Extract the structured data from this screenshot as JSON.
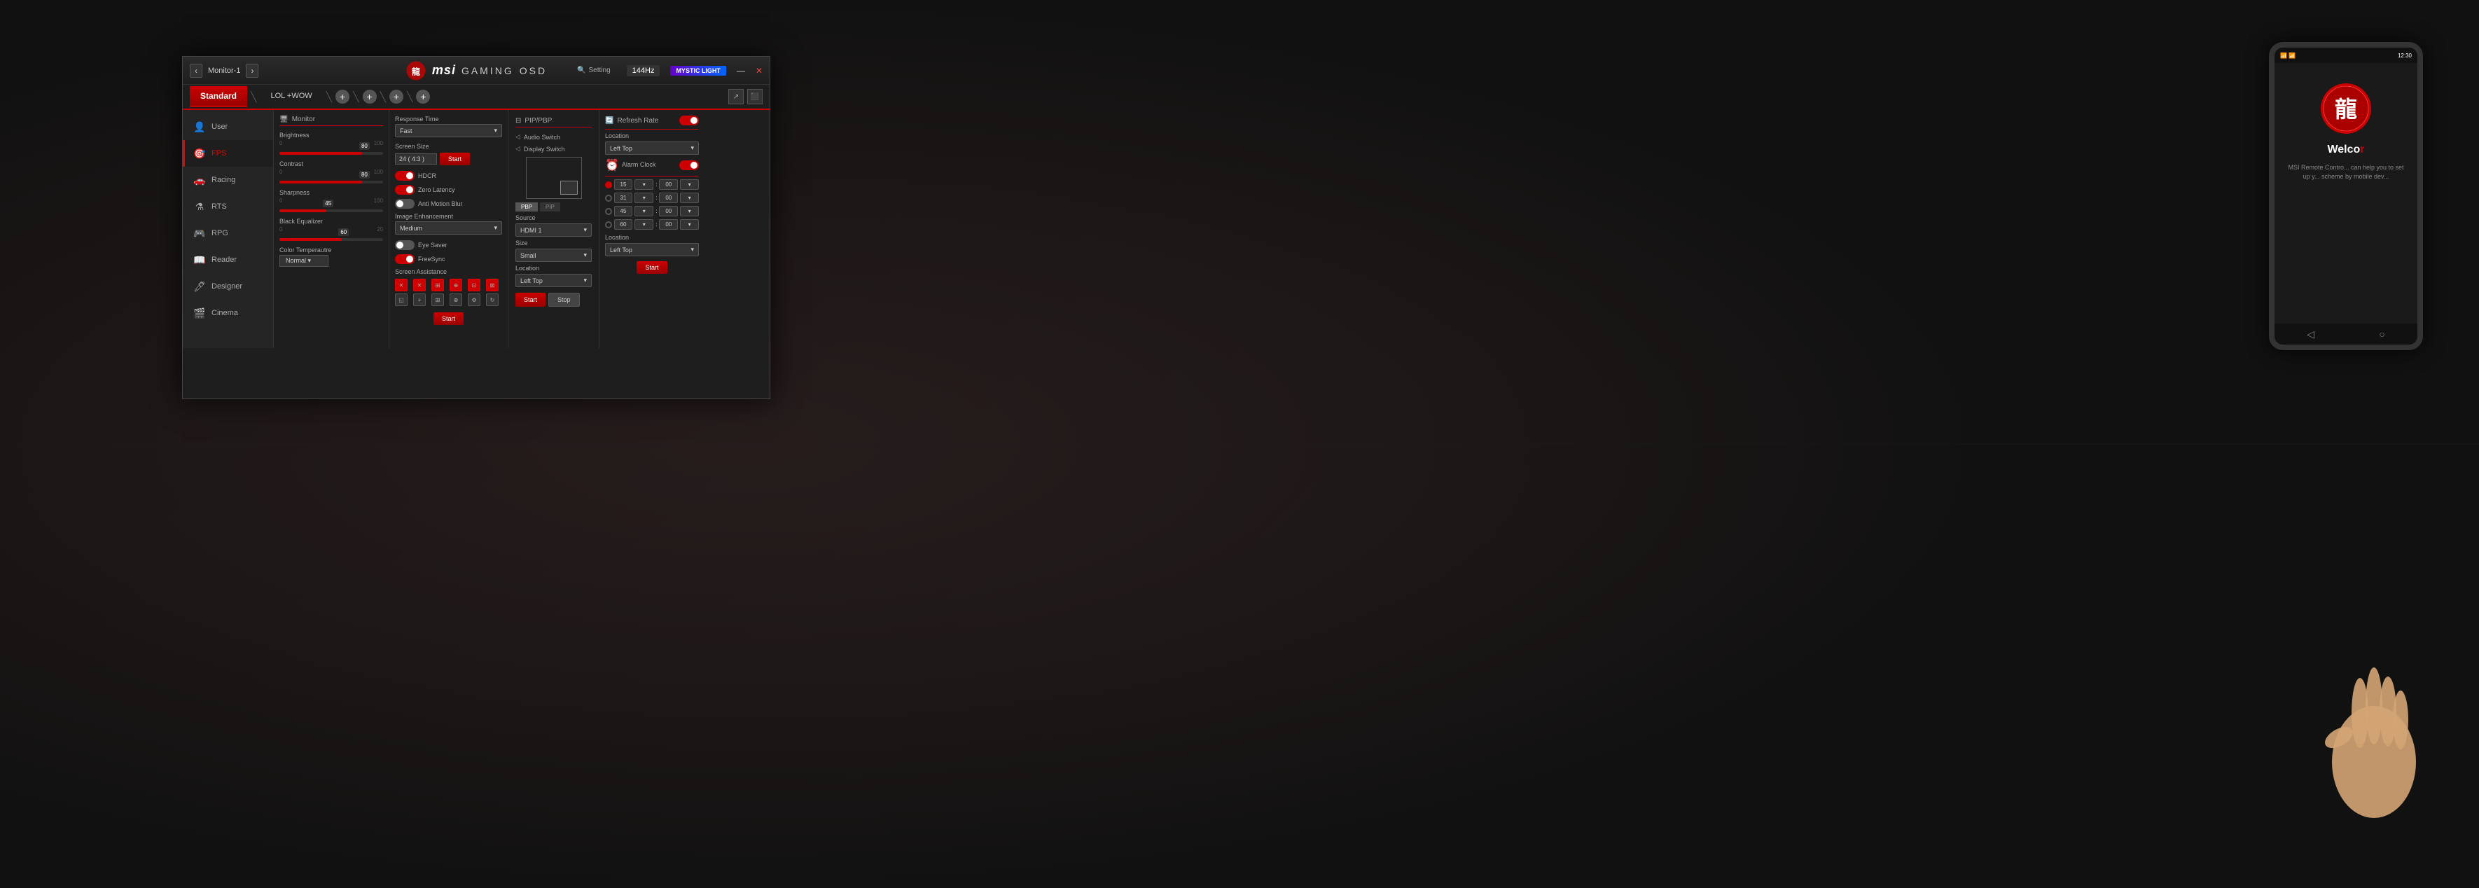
{
  "window": {
    "title": "MSI GAMING OSD",
    "monitor_label": "Monitor-1",
    "hz_display": "144Hz",
    "min_btn": "—",
    "close_btn": "✕",
    "toolbar": {
      "setting_label": "Setting",
      "mystic_label": "MYSTIC LIGHT"
    }
  },
  "profiles": {
    "standard_label": "Standard",
    "tab1_label": "LOL +WOW",
    "add_label": "+"
  },
  "sidebar": {
    "items": [
      {
        "id": "user",
        "label": "User",
        "icon": "👤"
      },
      {
        "id": "fps",
        "label": "FPS",
        "icon": "🎯",
        "active": true
      },
      {
        "id": "racing",
        "label": "Racing",
        "icon": "🏎"
      },
      {
        "id": "rts",
        "label": "RTS",
        "icon": "⚗"
      },
      {
        "id": "rpg",
        "label": "RPG",
        "icon": "🎮"
      },
      {
        "id": "reader",
        "label": "Reader",
        "icon": "📖"
      },
      {
        "id": "designer",
        "label": "Designer",
        "icon": "🖊"
      },
      {
        "id": "cinema",
        "label": "Cinema",
        "icon": "🎬"
      }
    ]
  },
  "monitor_section": {
    "title": "Monitor",
    "brightness": {
      "label": "Brightness",
      "value": 80,
      "min": 0,
      "max": 100
    },
    "contrast": {
      "label": "Contrast",
      "value": 80,
      "min": 0,
      "max": 100
    },
    "sharpness": {
      "label": "Sharpness",
      "value": 45,
      "min": 0,
      "max": 100
    },
    "black_equalizer": {
      "label": "Black Equalizer",
      "value": 60,
      "min": 0,
      "max": 20
    },
    "color_temp": {
      "label": "Color Temperautre",
      "value": "Normal"
    }
  },
  "response_section": {
    "response_time_label": "Response Time",
    "response_value": "Fast",
    "screen_size_label": "Screen Size",
    "screen_size_value": "24 ( 4:3 )",
    "start_label": "Start",
    "image_enhance_label": "Image Enhancement",
    "image_enhance_value": "Medium",
    "screen_assist_label": "Screen Assistance",
    "hdcr_label": "HDCR",
    "zero_latency_label": "Zero Latency",
    "anti_motion_label": "Anti Motion Blur",
    "eye_saver_label": "Eye Saver",
    "freesync_label": "FreeSync",
    "start_btn": "Start"
  },
  "pip_section": {
    "title": "PIP/PBP",
    "audio_switch_label": "Audio Switch",
    "display_switch_label": "Display Switch",
    "pbp_label": "PBP",
    "pip_label": "PIP",
    "source_label": "Source",
    "source_value": "HDMI 1",
    "size_label": "Size",
    "size_value": "Small",
    "location_label": "Location",
    "location_value": "Left Top",
    "start_label": "Start",
    "stop_label": "Stop"
  },
  "refresh_section": {
    "title": "Refresh Rate",
    "toggle": "on",
    "export_btn1": "↗",
    "export_btn2": "⬛",
    "location_label": "Location",
    "location_value": "Left Top",
    "alarm_clock_label": "Alarm Clock",
    "alarm_toggle": "on",
    "alarm_rows": [
      {
        "time_h": "15",
        "time_m": "00",
        "active": true
      },
      {
        "time_h": "31",
        "time_m": "00",
        "active": false
      },
      {
        "time_h": "45",
        "time_m": "00",
        "active": false
      },
      {
        "time_h": "60",
        "time_m": "00",
        "active": false
      }
    ],
    "location2_label": "Location",
    "location2_value": "Left Top",
    "start_label": "Start"
  },
  "phone": {
    "status_time": "12:30",
    "welcome_title": "Welco...",
    "welcome_desc": "MSI Remote Contro... can help you to set up y... scheme by mobile dev...",
    "nav_back": "◁",
    "nav_home": "○"
  }
}
